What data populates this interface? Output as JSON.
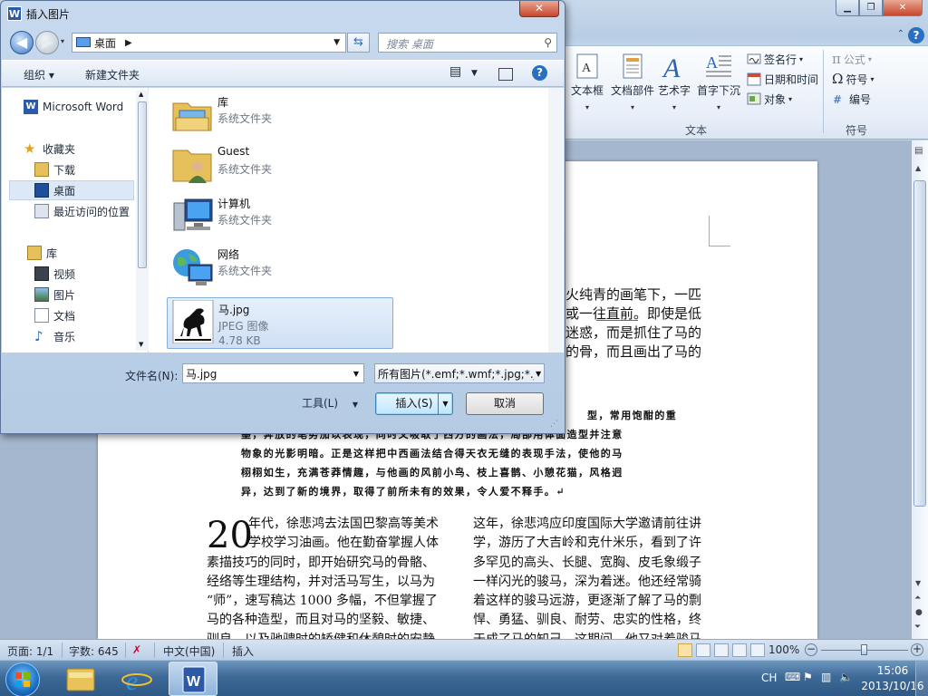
{
  "word": {
    "ribbon": {
      "groups": [
        {
          "label": "文本"
        },
        {
          "label": "符号"
        }
      ],
      "big_buttons": [
        "文本框",
        "文档部件",
        "艺术字",
        "首字下沉"
      ],
      "small_buttons": [
        "签名行",
        "日期和时间",
        "对象"
      ],
      "symbol_buttons": [
        "公式",
        "符号",
        "编号"
      ]
    },
    "document": {
      "upper_lines": [
        "火纯青的画笔下，一匹",
        "或一往直前。即使是低",
        "",
        "迷惑，而是抓住了马的",
        "的骨，而且画出了马的"
      ],
      "small_lines": [
        "型，常用饱酣的重",
        "墨，奔放的笔势加以表现，同时又吸取了西方的画法，局部用体面造型并注意",
        "物象的光影明暗。正是这样把中西画法结合得天衣无缝的表现手法，使他的马",
        "栩栩如生，充满苍莽情趣，与他画的风前小鸟、枝上喜鹊、小憩花猫，风格迥",
        "异，达到了新的境界，取得了前所未有的效果，令人爱不释手。↵"
      ],
      "dropcap": "20",
      "left_column": [
        "年代，徐悲鸿去法国巴黎高等美术",
        "学校学习油画。他在勤奋掌握人体",
        "素描技巧的同时，即开始研究马的骨骼、",
        "经络等生理结构，并对活马写生，以马为",
        "“师”，速写稿达 1000 多幅，不但掌握了",
        "马的各种造型，而且对马的坚毅、敏捷、",
        "驯良，以及驰骋时的矫健和休憩时的安静"
      ],
      "right_column": [
        "这年，徐悲鸿应印度国际大学邀请前往讲",
        "学，游历了大吉岭和克什米乐，看到了许",
        "多罕见的高头、长腿、宽胸、皮毛象缎子",
        "一样闪光的骏马，深为着迷。他还经常骑",
        "着这样的骏马远游，更逐渐了解了马的剽",
        "悍、勇猛、驯良、耐劳、忠实的性格，终",
        "于成了马的知己。这期间，他又对着骏马"
      ]
    },
    "statusbar": {
      "page": "页面: 1/1",
      "words": "字数: 645",
      "language": "中文(中国)",
      "mode": "插入",
      "zoom": "100%"
    }
  },
  "taskbar": {
    "lang": "CH",
    "time": "15:06",
    "date": "2013/10/16"
  },
  "dialog": {
    "title": "插入图片",
    "address": "桌面",
    "search_placeholder": "搜索 桌面",
    "toolbar": {
      "organize": "组织 ▾",
      "new_folder": "新建文件夹"
    },
    "nav": [
      {
        "label": "Microsoft Word",
        "icon": "word-icon"
      },
      {
        "label": "收藏夹",
        "icon": "star-icon"
      },
      {
        "label": "下载",
        "icon": "download-folder-icon"
      },
      {
        "label": "桌面",
        "icon": "desktop-icon"
      },
      {
        "label": "最近访问的位置",
        "icon": "recent-places-icon"
      },
      {
        "label": "库",
        "icon": "library-icon"
      },
      {
        "label": "视频",
        "icon": "video-icon"
      },
      {
        "label": "图片",
        "icon": "pictures-icon"
      },
      {
        "label": "文档",
        "icon": "documents-icon"
      },
      {
        "label": "音乐",
        "icon": "music-icon"
      }
    ],
    "files": [
      {
        "name": "库",
        "type": "系统文件夹",
        "icon": "library-folder-icon"
      },
      {
        "name": "Guest",
        "type": "系统文件夹",
        "icon": "user-folder-icon"
      },
      {
        "name": "计算机",
        "type": "系统文件夹",
        "icon": "computer-icon"
      },
      {
        "name": "网络",
        "type": "系统文件夹",
        "icon": "network-icon"
      },
      {
        "name": "马.jpg",
        "type": "JPEG 图像",
        "size": "4.78 KB",
        "icon": "horse-image-icon"
      }
    ],
    "filename_label": "文件名(N):",
    "filename_value": "马.jpg",
    "filter_value": "所有图片(*.emf;*.wmf;*.jpg;*.jp",
    "tools_label": "工具(L)",
    "insert_label": "插入(S)",
    "cancel_label": "取消"
  },
  "colors": {
    "accent": "#2a6fc0",
    "selection": "#cfe0f5"
  }
}
